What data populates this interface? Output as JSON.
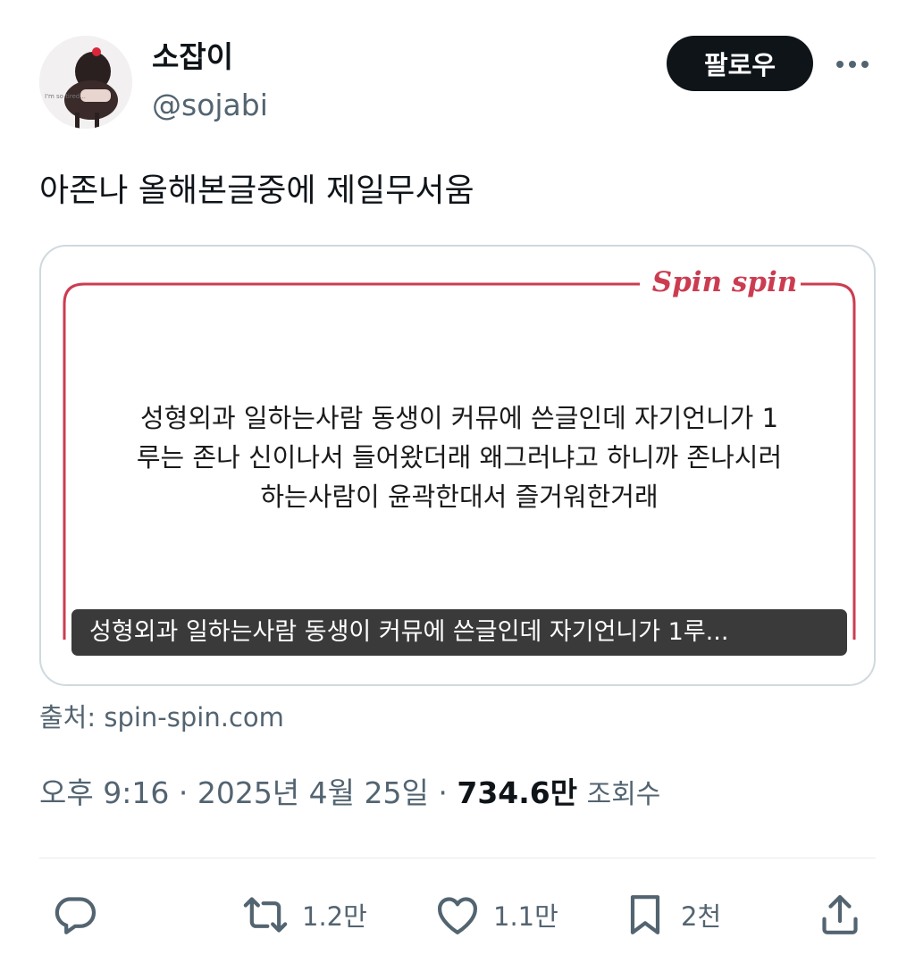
{
  "author": {
    "display_name": "소잡이",
    "handle": "@sojabi",
    "avatar_caption": "I'm so tired..."
  },
  "follow_label": "팔로우",
  "tweet_text": "아존나 올해본글중에 제일무서움",
  "card": {
    "brand": "Spin spin",
    "brand_color": "#cc3c51",
    "body_lines": [
      "성형외과 일하는사람 동생이 커뮤에 쓴글인데 자기언니가 1",
      "루는 존나 신이나서 들어왔더래 왜그러냐고 하니까 존나시러",
      "하는사람이 윤곽한대서 즐거워한거래"
    ],
    "caption": "성형외과 일하는사람 동생이 커뮤에 쓴글인데 자기언니가 1루..."
  },
  "source": "출처: spin-spin.com",
  "meta": {
    "time": "오후 9:16",
    "separator": "·",
    "date": "2025년 4월 25일",
    "views_count": "734.6만",
    "views_label": "조회수"
  },
  "actions": {
    "reply": {
      "icon": "reply-icon",
      "count": ""
    },
    "retweet": {
      "icon": "retweet-icon",
      "count": "1.2만"
    },
    "like": {
      "icon": "heart-icon",
      "count": "1.1만"
    },
    "bookmark": {
      "icon": "bookmark-icon",
      "count": "2천"
    },
    "share": {
      "icon": "share-icon",
      "count": ""
    }
  }
}
